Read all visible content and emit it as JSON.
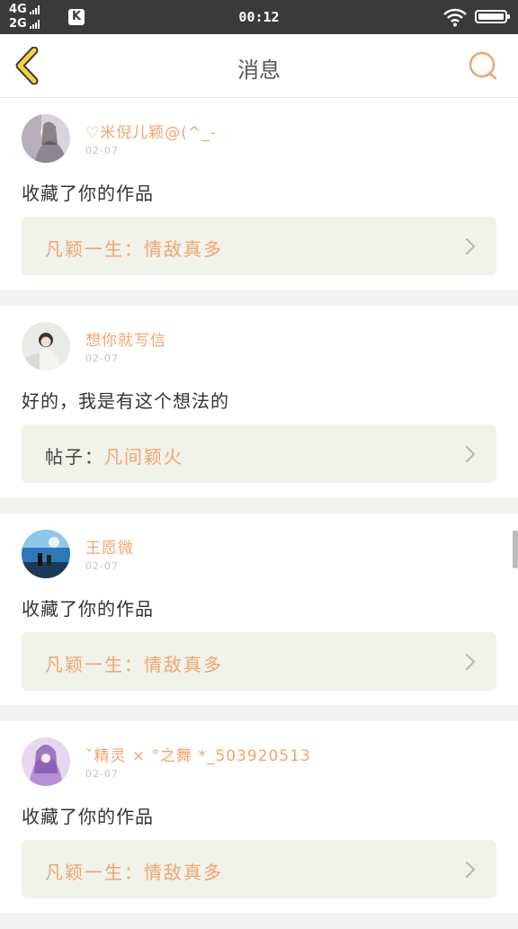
{
  "status": {
    "net1": "4G",
    "net2": "2G",
    "app_badge": "K",
    "time": "00:12"
  },
  "header": {
    "title": "消息"
  },
  "messages": [
    {
      "username": "♡米倪儿颖@(^_-",
      "date": "02-07",
      "action": "收藏了你的作品",
      "ref_prefix": "",
      "ref_title": "凡颖一生：情敌真多"
    },
    {
      "username": "想你就写信",
      "date": "02-07",
      "action": "好的，我是有这个想法的",
      "ref_prefix": "帖子：",
      "ref_title": "凡间颖火"
    },
    {
      "username": "王愿微",
      "date": "02-07",
      "action": "收藏了你的作品",
      "ref_prefix": "",
      "ref_title": "凡颖一生：情敌真多"
    },
    {
      "username": "ˇ精灵 × °之舞 *_503920513",
      "date": "02-07",
      "action": "收藏了你的作品",
      "ref_prefix": "",
      "ref_title": "凡颖一生：情敌真多"
    }
  ],
  "colors": {
    "accent": "#f0a56e",
    "back_arrow": "#f5d43a",
    "ref_bg": "#f1f2ea"
  }
}
